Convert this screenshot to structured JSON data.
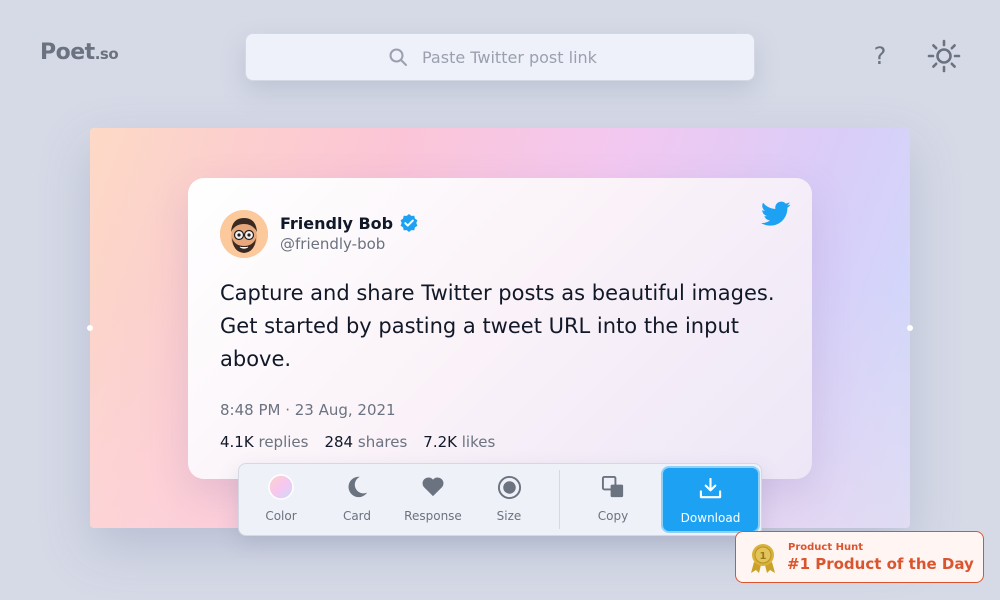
{
  "header": {
    "logo_main": "Poet",
    "logo_suffix": ".so",
    "search_placeholder": "Paste Twitter post link",
    "help_label": "?"
  },
  "tweet": {
    "author_name": "Friendly Bob",
    "author_handle": "@friendly-bob",
    "verified": true,
    "text": "Capture and share Twitter posts as beautiful images. Get started by pasting a tweet URL into the input above.",
    "timestamp": "8:48 PM · 23 Aug, 2021",
    "stats": {
      "replies_count": "4.1K",
      "replies_label": "replies",
      "shares_count": "284",
      "shares_label": "shares",
      "likes_count": "7.2K",
      "likes_label": "likes"
    }
  },
  "toolbar": {
    "color_label": "Color",
    "card_label": "Card",
    "response_label": "Response",
    "size_label": "Size",
    "copy_label": "Copy",
    "download_label": "Download"
  },
  "badge": {
    "small_text": "Product Hunt",
    "big_text": "#1 Product of the Day",
    "medal_number": "1"
  },
  "colors": {
    "accent": "#1da1f2",
    "product_hunt": "#da552f",
    "background": "#d6dae7"
  },
  "icons": [
    "search-icon",
    "help-icon",
    "sun-icon",
    "twitter-bird-icon",
    "verified-badge-icon",
    "color-swatch-icon",
    "moon-icon",
    "heart-icon",
    "record-icon",
    "copy-icon",
    "download-icon",
    "medal-icon"
  ]
}
